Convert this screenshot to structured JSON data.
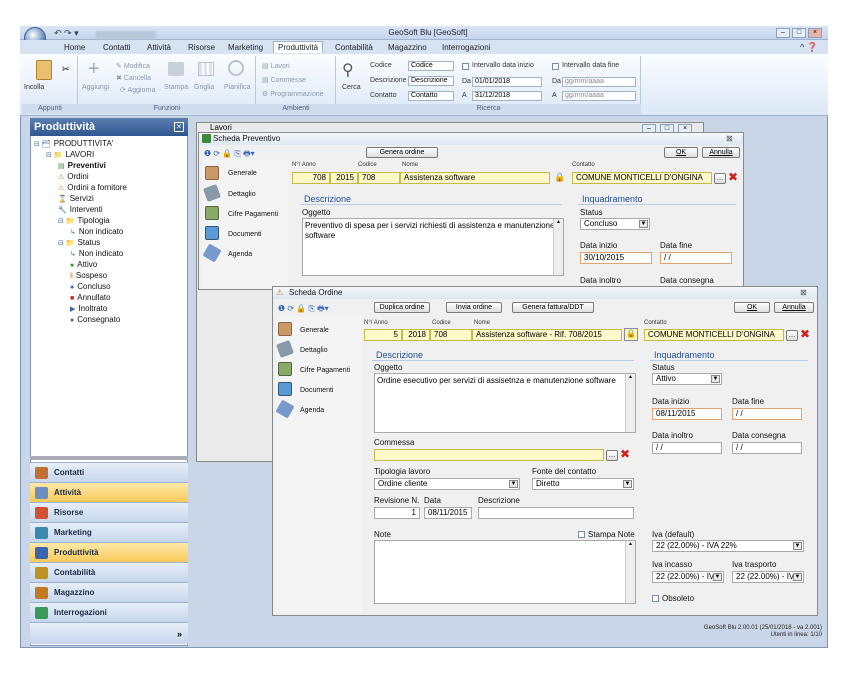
{
  "app": {
    "title": "GeoSoft Blu [GeoSoft]",
    "qat_blurred": "Microsoft Outlook"
  },
  "ribbon": {
    "tabs": [
      "Home",
      "Contatti",
      "Attività",
      "Risorse",
      "Marketing",
      "Produttività",
      "Contabilità",
      "Magazzino",
      "Interrogazioni"
    ],
    "active_tab": "Produttività",
    "groups": {
      "appunti": "Appunti",
      "funzioni": "Funzioni",
      "ambienti": "Ambienti",
      "ricerca": "Ricerca"
    },
    "buttons": {
      "incolla": "Incolla",
      "aggiungi": "Aggiungi",
      "modifica": "Modifica",
      "cancella": "Cancella",
      "aggiorna": "Aggiorna",
      "stampa": "Stampa",
      "griglia": "Griglia",
      "pianifica": "Pianifica",
      "lavori": "Lavori",
      "commesse": "Commesse",
      "programmazione": "Programmazione",
      "cerca": "Cerca"
    },
    "search": {
      "codice_label": "Codice",
      "codice_value": "Codice",
      "descrizione_label": "Descrizione",
      "descrizione_value": "Descrizione",
      "contatto_label": "Contatto",
      "contatto_value": "Contatto",
      "intervallo_inizio": "Intervallo data inizio",
      "intervallo_fine": "Intervallo data fine",
      "da_label": "Da",
      "a_label": "A",
      "inizio_da": "01/01/2018",
      "inizio_a": "31/12/2018",
      "fine_da": "gg/mm/aaaa",
      "fine_a": "gg/mm/aaaa"
    }
  },
  "left_panel": {
    "title": "Produttività",
    "tree": [
      {
        "label": "PRODUTTIVITA'",
        "level": 0
      },
      {
        "label": "LAVORI",
        "level": 1
      },
      {
        "label": "Preventivi",
        "level": 2,
        "bold": true
      },
      {
        "label": "Ordini",
        "level": 2
      },
      {
        "label": "Ordini a fornitore",
        "level": 2
      },
      {
        "label": "Servizi",
        "level": 2
      },
      {
        "label": "Interventi",
        "level": 2
      },
      {
        "label": "Tipologia",
        "level": 2
      },
      {
        "label": "Non indicato",
        "level": 3
      },
      {
        "label": "Status",
        "level": 2
      },
      {
        "label": "Non indicato",
        "level": 3
      },
      {
        "label": "Attivo",
        "level": 3
      },
      {
        "label": "Sospeso",
        "level": 3
      },
      {
        "label": "Concluso",
        "level": 3
      },
      {
        "label": "Annullato",
        "level": 3
      },
      {
        "label": "Inoltrato",
        "level": 3
      },
      {
        "label": "Consegnato",
        "level": 3
      }
    ],
    "nav": [
      "Contatti",
      "Attività",
      "Risorse",
      "Marketing",
      "Produttività",
      "Contabilità",
      "Magazzino",
      "Interrogazioni"
    ],
    "nav_highlight": [
      "Attività",
      "Produttività"
    ],
    "more": "»"
  },
  "lavori_window": {
    "title": "Lavori"
  },
  "preventivo": {
    "title": "Scheda Preventivo",
    "genera_ordine": "Genera ordine",
    "ok": "OK",
    "annulla": "Annulla",
    "side": [
      "Generale",
      "Dettaglio",
      "Cifre Pagamenti",
      "Documenti",
      "Agenda"
    ],
    "labels": {
      "nanno": "N°/ Anno",
      "codice": "Codice",
      "nome": "Nome",
      "contatto": "Contatto"
    },
    "numero": "708",
    "anno": "2015",
    "codice": "708",
    "nome": "Assistenza software",
    "contatto": "COMUNE MONTICELLI D'ONGINA",
    "descrizione_section": "Descrizione",
    "oggetto_label": "Oggetto",
    "oggetto": "Preventivo di spesa per i servizi richiesti di assistenza e manutenzione software",
    "inquadramento": "Inquadramento",
    "status_label": "Status",
    "status": "Concluso",
    "data_inizio_label": "Data inizio",
    "data_inizio": "30/10/2015",
    "data_fine_label": "Data fine",
    "data_fine": " / /",
    "data_inoltro_label": "Data inoltro",
    "data_consegna_label": "Data consegna"
  },
  "ordine": {
    "title": "Scheda Ordine",
    "duplica": "Duplica ordine",
    "invia": "Invia ordine",
    "genera_fattura": "Genera fattura/DDT",
    "ok": "OK",
    "annulla": "Annulla",
    "side": [
      "Generale",
      "Dettaglio",
      "Cifre Pagamenti",
      "Documenti",
      "Agenda"
    ],
    "labels": {
      "nanno": "N°/ Anno",
      "codice": "Codice",
      "nome": "Nome",
      "contatto": "Contatto"
    },
    "numero": "5",
    "anno": "2018",
    "codice": "708",
    "nome": "Assistenza software - Rif. 708/2015",
    "contatto": "COMUNE MONTICELLI D'ONGINA",
    "descrizione_section": "Descrizione",
    "oggetto_label": "Oggetto",
    "oggetto": "Ordine esecutivo per servizi di assisetnza e manutenzione software",
    "commessa_label": "Commessa",
    "tipologia_label": "Tipologia lavoro",
    "tipologia": "Ordine cliente",
    "fonte_label": "Fonte del contatto",
    "fonte": "Diretto",
    "revisione_label": "Revisione N.",
    "revisione": "1",
    "data_label": "Data",
    "data": "08/11/2015",
    "descrizione_label": "Descrizione",
    "note_label": "Note",
    "stampa_note": "Stampa Note",
    "inquadramento": "Inquadramento",
    "status_label": "Status",
    "status": "Attivo",
    "data_inizio_label": "Data inizio",
    "data_inizio": "08/11/2015",
    "data_fine_label": "Data fine",
    "data_fine": " / /",
    "data_inoltro_label": "Data inoltro",
    "data_inoltro": " / /",
    "data_consegna_label": "Data consegna",
    "data_consegna": " / /",
    "iva_default_label": "Iva (default)",
    "iva_default": "22 (22.00%) - IVA 22%",
    "iva_incasso_label": "Iva incasso",
    "iva_incasso": "22 (22.00%) - IV",
    "iva_trasporto_label": "Iva trasporto",
    "iva_trasporto": "22 (22.00%) - IV",
    "obsoleto": "Obsoleto"
  },
  "status_bar": {
    "version": "GeoSoft Blu 2.00.01 (25/01/2018 - va 2.001)",
    "users": "Utenti in linea: 1/10"
  }
}
